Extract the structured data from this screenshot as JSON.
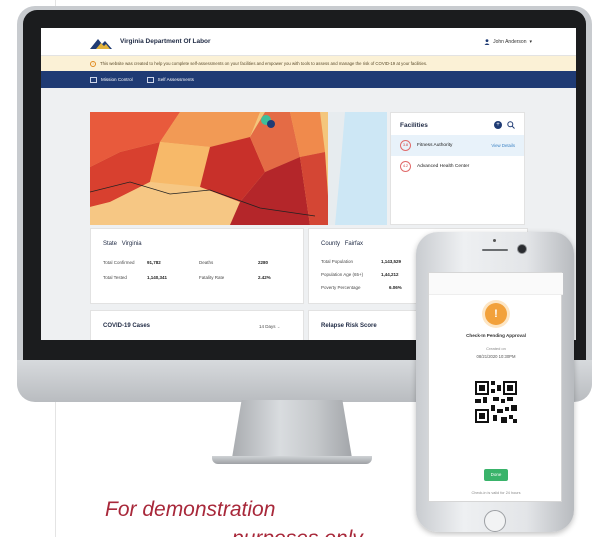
{
  "app": {
    "title": "Virginia Department Of Labor",
    "user": "John Anderson"
  },
  "notice": "This website was created to help you complete self-assessments on your facilities and empower you with tools to assess and manage the risk of COVID-19 at your facilities.",
  "nav": {
    "items": [
      {
        "label": "Mission Control"
      },
      {
        "label": "Self Assessments"
      }
    ]
  },
  "facilities": {
    "title": "Facilities",
    "items": [
      {
        "score": "3.8",
        "name": "Fitness Authority",
        "link": "View Details"
      },
      {
        "score": "4.2",
        "name": "Advanced Health Center",
        "link": ""
      }
    ]
  },
  "state_card": {
    "label": "State",
    "name": "Virginia",
    "rows": [
      {
        "k1": "Total Confirmed",
        "v1": "91,782",
        "k2": "Deaths",
        "v2": "2280"
      },
      {
        "k1": "Total Tested",
        "v1": "1,140,341",
        "k2": "Fatality Rate",
        "v2": "2.42%"
      }
    ]
  },
  "county_card": {
    "label": "County",
    "name": "Fairfax",
    "rows": [
      {
        "k": "Total Population",
        "v": "1,143,529"
      },
      {
        "k": "Population Age (65+)",
        "v": "1,44,212"
      },
      {
        "k": "Poverty Percentage",
        "v": "6.06%"
      }
    ]
  },
  "cases_card": {
    "title": "COVID-19 Cases",
    "range": "14 Days"
  },
  "relapse_card": {
    "title": "Relapse Risk Score"
  },
  "phone": {
    "status": "Check-In Pending Approval",
    "created": "Created on",
    "date": "08/21/2020 10:30PM",
    "done": "Done",
    "footer": "Check-in is valid for 24 hours"
  },
  "caption": {
    "line1": "For demonstration",
    "line2": "purposes only"
  },
  "colors": {
    "navy": "#1f3b74",
    "accent_red": "#a8283a",
    "pending_orange": "#f2a13b",
    "done_green": "#39b36a"
  }
}
